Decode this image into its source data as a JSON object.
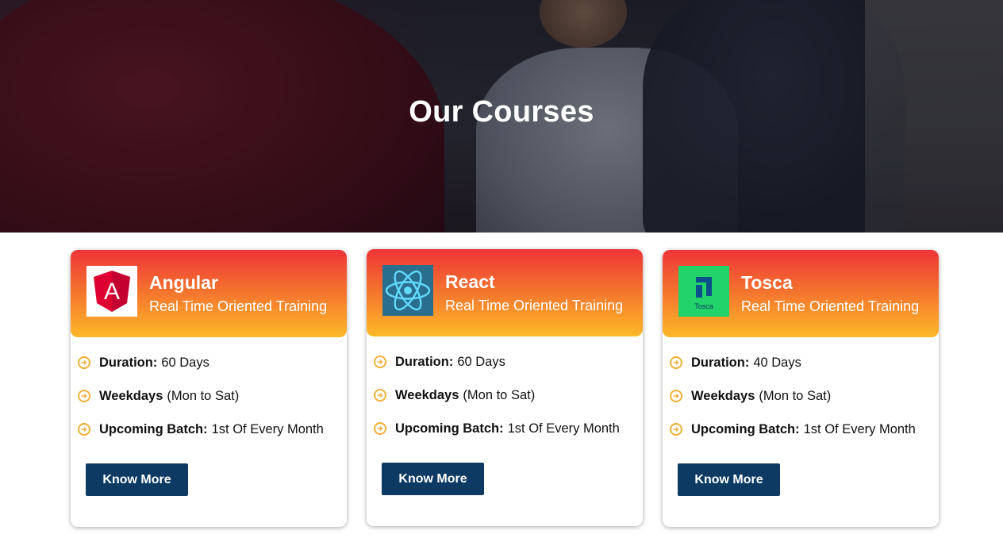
{
  "hero": {
    "title": "Our Courses"
  },
  "courses": [
    {
      "name": "Angular",
      "subtitle": "Real Time Oriented Training",
      "logo_icon": "angular-logo-icon",
      "logo_letter": "A",
      "duration_label": "Duration:",
      "duration_value": "60 Days",
      "weekdays_label": "Weekdays",
      "weekdays_value": "(Mon to Sat)",
      "batch_label": "Upcoming Batch:",
      "batch_value": "1st Of Every Month",
      "button_label": "Know More"
    },
    {
      "name": "React",
      "subtitle": "Real Time Oriented Training",
      "logo_icon": "react-logo-icon",
      "duration_label": "Duration:",
      "duration_value": "60 Days",
      "weekdays_label": "Weekdays",
      "weekdays_value": "(Mon to Sat)",
      "batch_label": "Upcoming Batch:",
      "batch_value": "1st Of Every Month",
      "button_label": "Know More"
    },
    {
      "name": "Tosca",
      "subtitle": "Real Time Oriented Training",
      "logo_icon": "tosca-logo-icon",
      "logo_text": "Tosca",
      "duration_label": "Duration:",
      "duration_value": "40 Days",
      "weekdays_label": "Weekdays",
      "weekdays_value": "(Mon to Sat)",
      "batch_label": "Upcoming Batch:",
      "batch_value": "1st Of Every Month",
      "button_label": "Know More"
    }
  ],
  "colors": {
    "header_gradient_top": "#ef3438",
    "header_gradient_bottom": "#fdb928",
    "button": "#0c3a63",
    "bullet": "#f0b03a"
  }
}
